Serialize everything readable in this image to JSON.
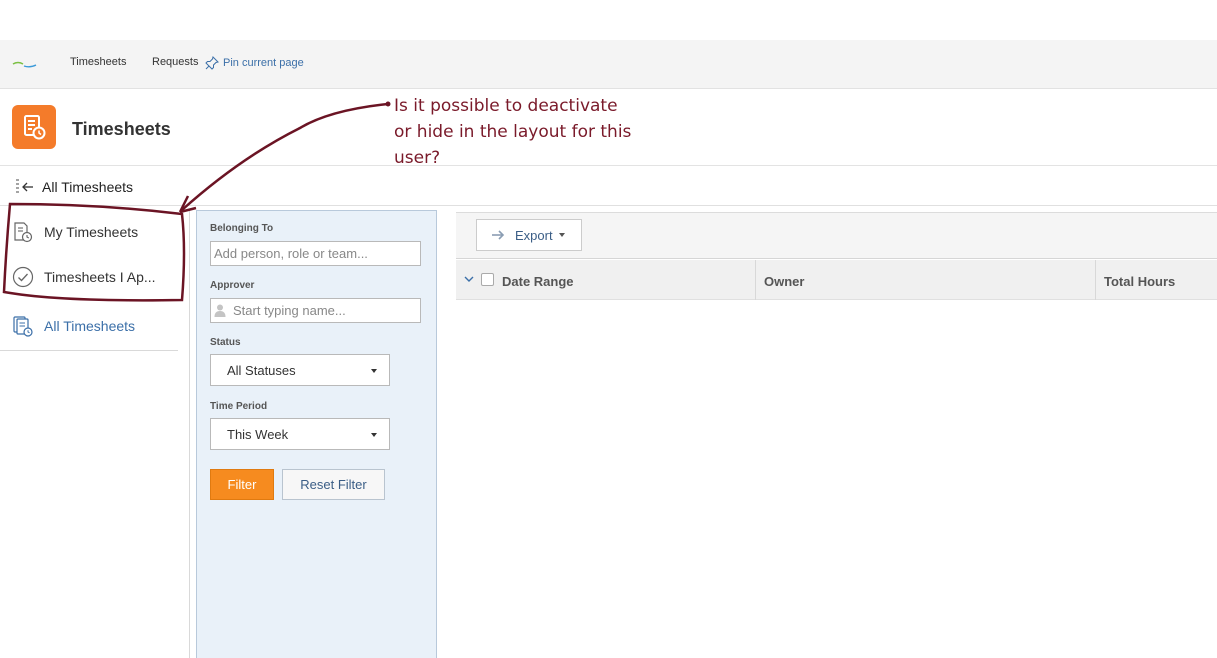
{
  "topbar": {
    "nav": [
      "Timesheets",
      "Requests"
    ],
    "pin_label": "Pin current page"
  },
  "app": {
    "title": "Timesheets"
  },
  "subheader": {
    "back_label": "All Timesheets"
  },
  "sidebar": {
    "items": [
      {
        "label": "My Timesheets",
        "icon": "document-clock-icon"
      },
      {
        "label": "Timesheets I Ap...",
        "icon": "check-circle-icon"
      },
      {
        "label": "All Timesheets",
        "icon": "documents-clock-icon"
      }
    ]
  },
  "filters": {
    "belonging_label": "Belonging To",
    "belonging_placeholder": "Add person, role or team...",
    "approver_label": "Approver",
    "approver_placeholder": "Start typing name...",
    "status_label": "Status",
    "status_value": "All Statuses",
    "period_label": "Time Period",
    "period_value": "This Week",
    "filter_button": "Filter",
    "reset_button": "Reset Filter"
  },
  "toolbar": {
    "export_label": "Export"
  },
  "grid": {
    "columns": [
      "Date Range",
      "Owner",
      "Total Hours"
    ]
  },
  "annotation": {
    "text": "Is it possible to deactivate or hide in the layout for this user?"
  },
  "colors": {
    "accent": "#f68b1f",
    "link": "#3b6fa8",
    "panel": "#e9f1f9",
    "annotation": "#7a1a2a"
  }
}
